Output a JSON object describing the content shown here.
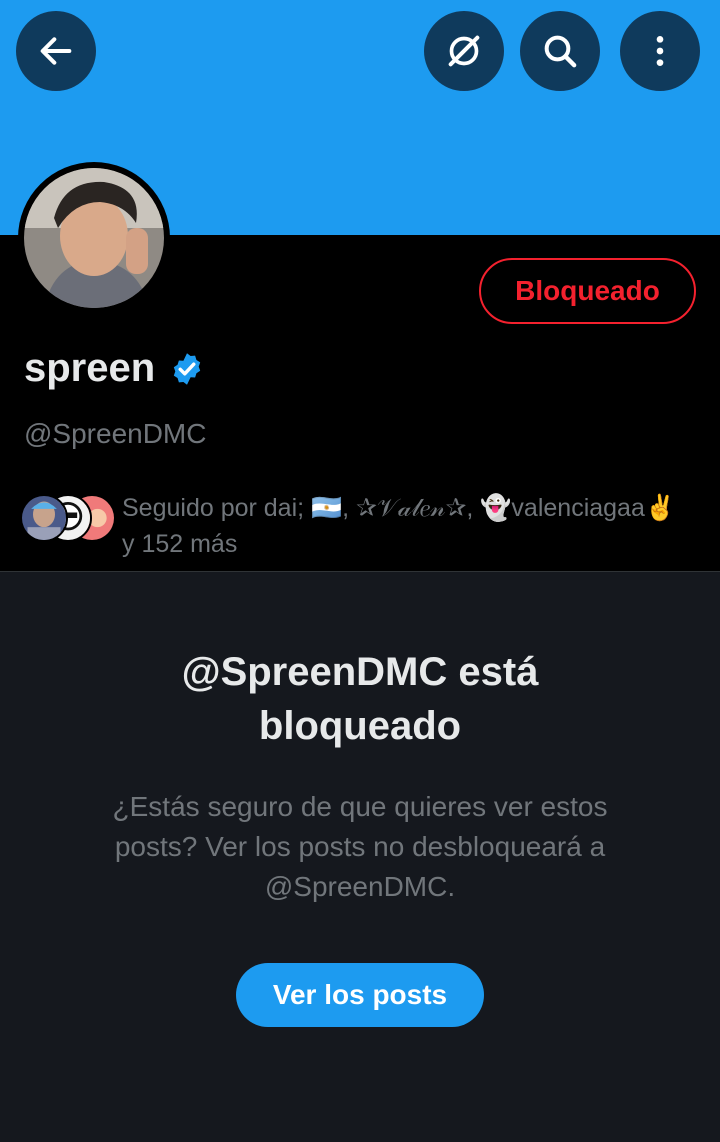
{
  "header": {
    "back_icon": "arrow-left-icon",
    "grok_icon": "grok-icon",
    "search_icon": "search-icon",
    "more_icon": "more-vertical-icon",
    "banner_color": "#1d9bf0"
  },
  "profile": {
    "display_name": "spreen",
    "verified_icon": "verified-badge-icon",
    "handle": "@SpreenDMC",
    "blocked_button_label": "Bloqueado",
    "followed_by": "Seguido por dai; 🇦🇷, ✰𝒱𝒶𝓁𝑒𝓃✰, 👻valenciagaa✌️",
    "followed_by_more": "y 152 más"
  },
  "blocked_notice": {
    "title": "@SpreenDMC está bloqueado",
    "description": "¿Estás seguro de que quieres ver estos posts? Ver los posts no desbloqueará a @SpreenDMC.",
    "view_posts_label": "Ver los posts"
  },
  "colors": {
    "accent": "#1d9bf0",
    "blocked_red": "#f4212e",
    "muted_text": "#71767b"
  }
}
